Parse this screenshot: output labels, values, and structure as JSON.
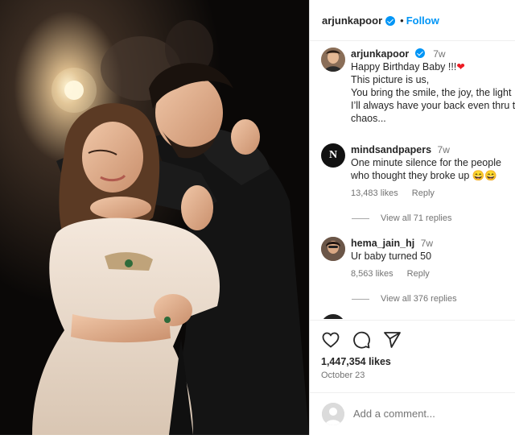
{
  "header": {
    "username": "arjunkapoor",
    "separator": "•",
    "follow_label": "Follow"
  },
  "caption": {
    "username": "arjunkapoor",
    "time": "7w",
    "lines": [
      "Happy Birthday Baby !!!",
      "This picture is us,",
      "You bring the smile, the joy, the light",
      "I’ll always have your back even thru the",
      "chaos..."
    ]
  },
  "comments": [
    {
      "username": "mindsandpapers",
      "time": "7w",
      "text_lines": [
        "One minute silence for the people",
        "who thought they broke up 😄😄"
      ],
      "likes": "13,483 likes",
      "reply_label": "Reply",
      "view_replies": "View all 71 replies",
      "avatar_letter": "N"
    },
    {
      "username": "hema_jain_hj",
      "time": "7w",
      "text_lines": [
        "Ur baby turned 50"
      ],
      "likes": "8,563 likes",
      "reply_label": "Reply",
      "view_replies": "View all 376 replies"
    }
  ],
  "actions": {
    "icons": [
      "heart-icon",
      "comment-icon",
      "share-icon"
    ],
    "likes": "1,447,354 likes",
    "date": "October 23"
  },
  "comment_box": {
    "placeholder": "Add a comment..."
  },
  "colors": {
    "accent": "#0095f6",
    "heart": "#ed1c24",
    "muted": "#737373"
  }
}
